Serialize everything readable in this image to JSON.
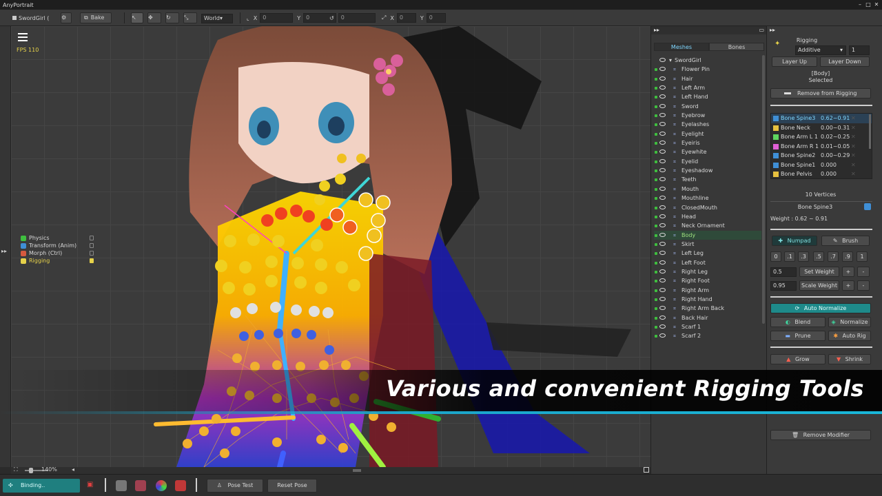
{
  "window": {
    "title": "AnyPortrait"
  },
  "toolbar": {
    "scene_label": "SwordGirl (",
    "bake_label": "Bake",
    "space_label": "World",
    "pos_x_label": "X",
    "pos_x_value": "0",
    "pos_y_label": "Y",
    "pos_y_value": "0",
    "rot_value": "0",
    "scale_x_label": "X",
    "scale_x_value": "0",
    "scale_y_label": "Y",
    "scale_y_value": "0"
  },
  "viewport": {
    "fps": "FPS 110",
    "zoom": "140%",
    "modifiers": [
      {
        "label": "Physics",
        "color": "#3fbf3f"
      },
      {
        "label": "Transform (Anim)",
        "color": "#3f8fd6"
      },
      {
        "label": "Morph (Ctrl)",
        "color": "#d65a3f"
      },
      {
        "label": "Rigging",
        "color": "#e6d24a"
      }
    ]
  },
  "hierarchy": {
    "tabs": [
      "Meshes",
      "Bones"
    ],
    "root": "SwordGirl",
    "items": [
      "Flower Pin",
      "Hair",
      "Left Arm",
      "Left Hand",
      "Sword",
      "Eyebrow",
      "Eyelashes",
      "Eyelight",
      "Eyeiris",
      "Eyewhite",
      "Eyelid",
      "Eyeshadow",
      "Teeth",
      "Mouth",
      "Mouthline",
      "ClosedMouth",
      "Head",
      "Neck Ornament",
      "Body",
      "Skirt",
      "Left Leg",
      "Left Foot",
      "Right Leg",
      "Right Foot",
      "Right Arm",
      "Right Hand",
      "Right Arm Back",
      "Back Hair",
      "Scarf 1",
      "Scarf 2"
    ],
    "selected": "Body"
  },
  "inspector": {
    "title": "Rigging",
    "blend_mode": "Additive",
    "layer_value": "1",
    "layer_up": "Layer Up",
    "layer_down": "Layer Down",
    "target_name": "[Body]",
    "target_state": "Selected",
    "remove_from_rigging": "Remove from Rigging",
    "bones": [
      {
        "name": "Bone Spine3",
        "weight": "0.62~0.91",
        "color": "#3f8fd6"
      },
      {
        "name": "Bone Neck",
        "weight": "0.00~0.31",
        "color": "#e6c03f"
      },
      {
        "name": "Bone Arm L 1",
        "weight": "0.02~0.25",
        "color": "#5fd65f"
      },
      {
        "name": "Bone Arm R 1",
        "weight": "0.01~0.05",
        "color": "#e05fd6"
      },
      {
        "name": "Bone Spine2",
        "weight": "0.00~0.29",
        "color": "#3f8fd6"
      },
      {
        "name": "Bone Spine1",
        "weight": "0.000",
        "color": "#3f8fd6"
      },
      {
        "name": "Bone Pelvis",
        "weight": "0.000",
        "color": "#e6c03f"
      }
    ],
    "vertices_label": "10 Vertices",
    "current_bone": "Bone Spine3",
    "weight_label": "Weight : 0.62 ~ 0.91",
    "numpad_label": "Numpad",
    "brush_label": "Brush",
    "numpad_values": [
      "0",
      ".1",
      ".3",
      ".5",
      ".7",
      ".9",
      "1"
    ],
    "set_weight_value": "0.5",
    "set_weight_label": "Set Weight",
    "scale_weight_value": "0.95",
    "scale_weight_label": "Scale Weight",
    "plus": "+",
    "minus": "-",
    "auto_normalize": "Auto Normalize",
    "blend": "Blend",
    "normalize": "Normalize",
    "prune": "Prune",
    "auto_rig": "Auto Rig",
    "grow": "Grow",
    "shrink": "Shrink",
    "remove_modifier": "Remove Modifier"
  },
  "bottombar": {
    "status": "Binding..",
    "pose_test": "Pose Test",
    "reset_pose": "Reset Pose"
  },
  "caption": "Various and convenient Rigging Tools",
  "colors": {
    "accent_teal": "#1e8a8a",
    "highlight_blue": "#7fd7ff",
    "caption_line": "#19b7d9"
  }
}
